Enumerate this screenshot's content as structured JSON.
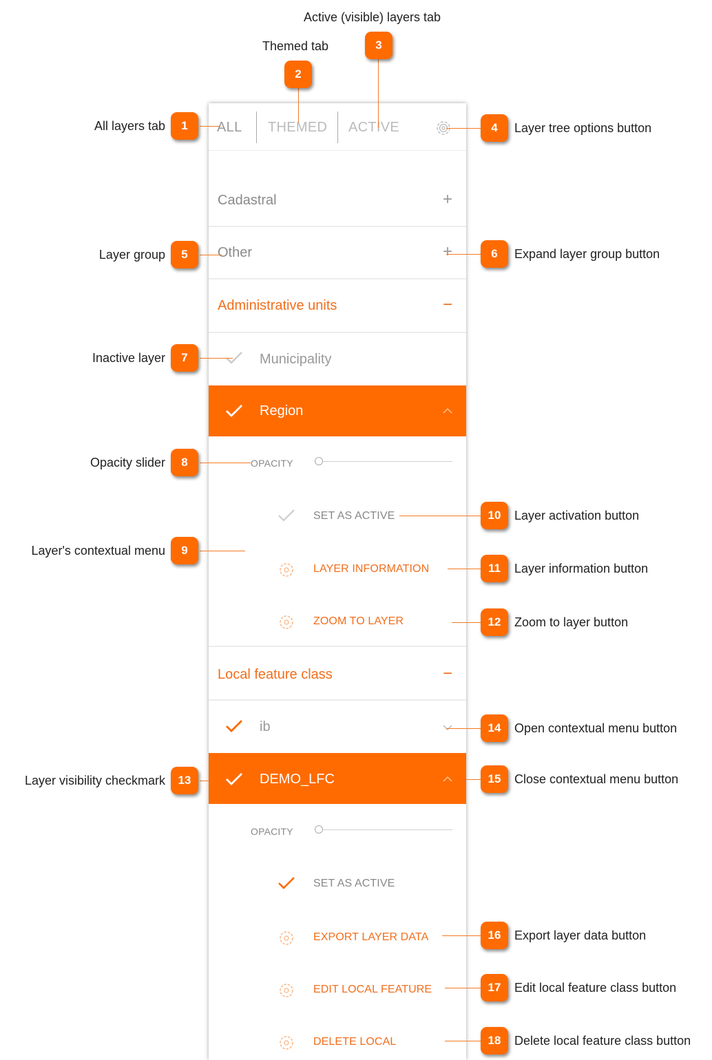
{
  "tabs": {
    "all": "ALL",
    "themed": "THEMED",
    "active": "ACTIVE"
  },
  "groups": [
    {
      "label": "Cadastral",
      "toggle": "+"
    },
    {
      "label": "Other",
      "toggle": "+"
    },
    {
      "label": "Administrative units",
      "toggle": "−"
    },
    {
      "label": "Local feature class",
      "toggle": "−"
    }
  ],
  "layers": {
    "municipality": "Municipality",
    "region": "Region",
    "ib": "ib",
    "demo_lfc": "DEMO_LFC"
  },
  "region_menu": {
    "opacity": "OPACITY",
    "opacity_value": 0,
    "set_active": "SET AS ACTIVE",
    "layer_info": "LAYER INFORMATION",
    "zoom": "ZOOM TO LAYER"
  },
  "demo_menu": {
    "opacity": "OPACITY",
    "opacity_value": 0,
    "set_active": "SET AS ACTIVE",
    "export": "EXPORT LAYER DATA",
    "edit": "EDIT LOCAL FEATURE",
    "delete": "DELETE LOCAL"
  },
  "callouts": [
    {
      "n": "1",
      "text": "All layers tab"
    },
    {
      "n": "2",
      "text": "Themed tab"
    },
    {
      "n": "3",
      "text": "Active (visible) layers tab"
    },
    {
      "n": "4",
      "text": "Layer tree options button"
    },
    {
      "n": "5",
      "text": "Layer group"
    },
    {
      "n": "6",
      "text": "Expand layer group button"
    },
    {
      "n": "7",
      "text": "Inactive layer"
    },
    {
      "n": "8",
      "text": "Opacity slider"
    },
    {
      "n": "9",
      "text": "Layer's contextual menu"
    },
    {
      "n": "10",
      "text": "Layer activation button"
    },
    {
      "n": "11",
      "text": "Layer information button"
    },
    {
      "n": "12",
      "text": "Zoom to layer button"
    },
    {
      "n": "13",
      "text": "Layer visibility checkmark"
    },
    {
      "n": "14",
      "text": "Open contextual menu button"
    },
    {
      "n": "15",
      "text": "Close contextual menu button"
    },
    {
      "n": "16",
      "text": "Export layer data button"
    },
    {
      "n": "17",
      "text": "Edit local feature class button"
    },
    {
      "n": "18",
      "text": "Delete local feature class button"
    }
  ],
  "colors": {
    "accent": "#ff6b00",
    "accent_text": "#f26e1c",
    "muted": "#8a8a8a"
  }
}
